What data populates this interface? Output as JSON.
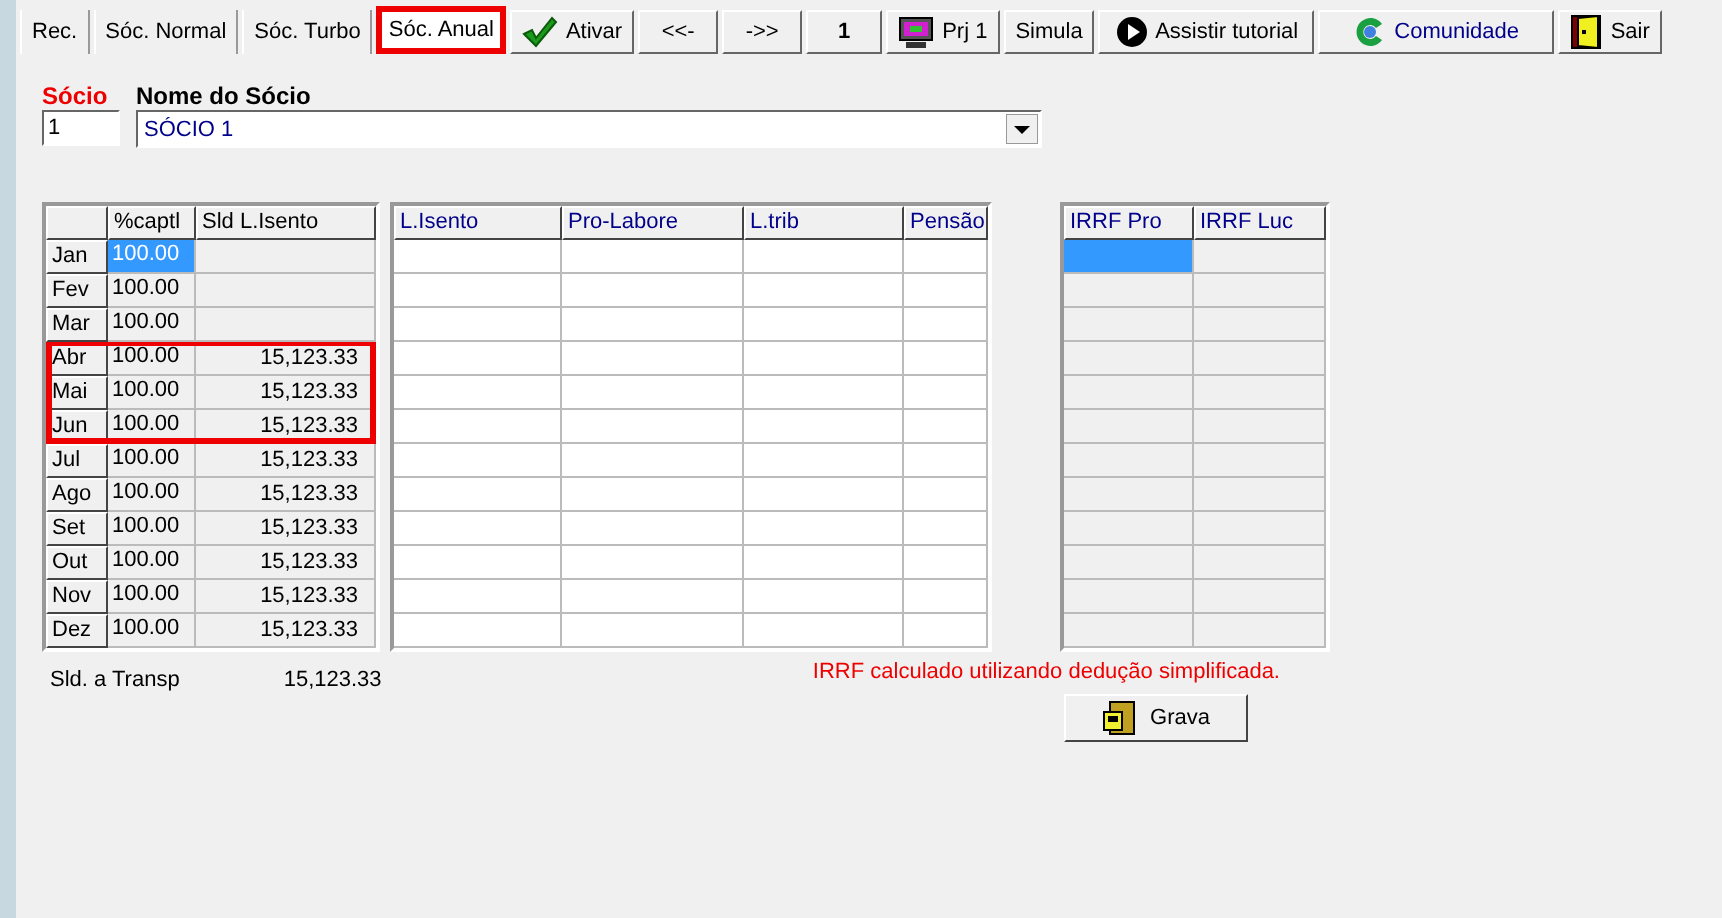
{
  "tabs": [
    {
      "label": "Rec.",
      "selected": false,
      "highlighted": false
    },
    {
      "label": "Sóc. Normal",
      "selected": false,
      "highlighted": false
    },
    {
      "label": "Sóc. Turbo",
      "selected": false,
      "highlighted": false
    },
    {
      "label": "Sóc. Anual",
      "selected": true,
      "highlighted": true
    }
  ],
  "toolbar": [
    {
      "label": "Ativar",
      "kind": "check"
    },
    {
      "label": "<<-",
      "kind": "plain"
    },
    {
      "label": "->>",
      "kind": "plain"
    },
    {
      "label": "1",
      "kind": "counter"
    },
    {
      "label": "Prj 1",
      "kind": "monitor"
    },
    {
      "label": "Simula",
      "kind": "plain"
    },
    {
      "label": "Assistir tutorial",
      "kind": "play"
    },
    {
      "label": "Comunidade",
      "kind": "globe"
    },
    {
      "label": "Sair",
      "kind": "door"
    }
  ],
  "socio": {
    "label": "Sócio",
    "value": "1"
  },
  "nome": {
    "label": "Nome do Sócio",
    "value": "SÓCIO 1"
  },
  "table1": {
    "columns": [
      "%captl",
      "Sld L.Isento"
    ],
    "rows": [
      {
        "month": "Jan",
        "captl": "100.00",
        "selected": true,
        "highlighted": false
      },
      {
        "month": "Fev",
        "captl": "100.00",
        "selected": false,
        "highlighted": false
      },
      {
        "month": "Mar",
        "captl": "100.00",
        "selected": false,
        "highlighted": false
      },
      {
        "month": "Abr",
        "captl": "100.00",
        "sld": "15,123.33",
        "selected": false,
        "highlighted": true
      },
      {
        "month": "Mai",
        "captl": "100.00",
        "sld": "15,123.33",
        "selected": false,
        "highlighted": true
      },
      {
        "month": "Jun",
        "captl": "100.00",
        "sld": "15,123.33",
        "selected": false,
        "highlighted": true
      },
      {
        "month": "Jul",
        "captl": "100.00",
        "sld": "15,123.33",
        "selected": false,
        "highlighted": false
      },
      {
        "month": "Ago",
        "captl": "100.00",
        "sld": "15,123.33",
        "selected": false,
        "highlighted": false
      },
      {
        "month": "Set",
        "captl": "100.00",
        "sld": "15,123.33",
        "selected": false,
        "highlighted": false
      },
      {
        "month": "Out",
        "captl": "100.00",
        "sld": "15,123.33",
        "selected": false,
        "highlighted": false
      },
      {
        "month": "Nov",
        "captl": "100.00",
        "sld": "15,123.33",
        "selected": false,
        "highlighted": false
      },
      {
        "month": "Dez",
        "captl": "100.00",
        "sld": "15,123.33",
        "selected": false,
        "highlighted": false
      }
    ]
  },
  "table2": {
    "columns": [
      "L.Isento",
      "Pro-Labore",
      "L.trib",
      "Pensão"
    ]
  },
  "table3": {
    "columns": [
      "IRRF Pro",
      "IRRF Luc"
    ]
  },
  "transp": {
    "label": "Sld. a Transp",
    "value": "15,123.33"
  },
  "notice": "IRRF calculado utilizando dedução simplificada.",
  "save_button": {
    "label": "Grava"
  }
}
